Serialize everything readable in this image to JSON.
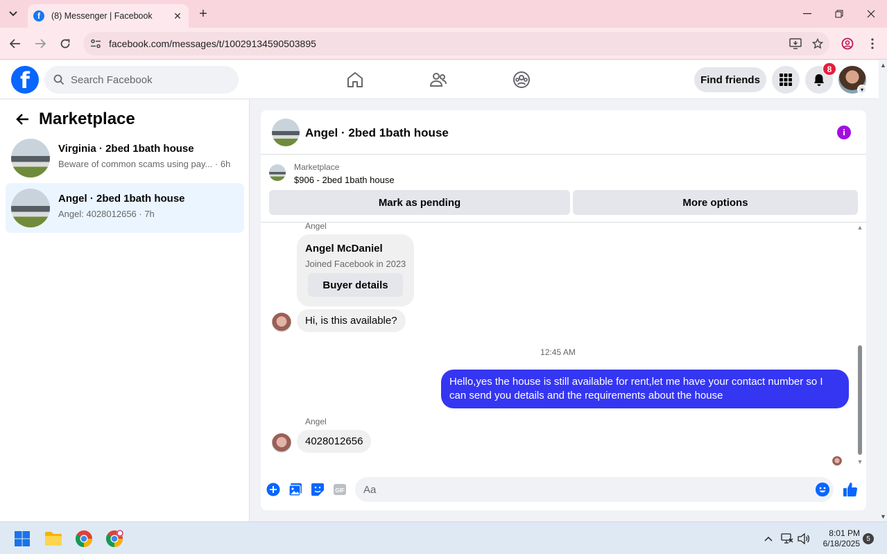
{
  "browser": {
    "tab_title": "(8) Messenger | Facebook",
    "tab_favicon": "f",
    "url": "facebook.com/messages/t/10029134590503895",
    "new_tab_label": "+"
  },
  "fb_header": {
    "search_placeholder": "Search Facebook",
    "find_friends_label": "Find friends",
    "notification_count": "8",
    "logo_letter": "f",
    "brand_color": "#0866ff",
    "badge_color": "#e41e3f"
  },
  "left_panel": {
    "title": "Marketplace",
    "conversations": [
      {
        "name": "Virginia · 2bed 1bath house",
        "preview": "Beware of common scams using pay...",
        "time": "· 6h",
        "active": false
      },
      {
        "name": "Angel · 2bed 1bath house",
        "preview": "Angel: 4028012656 · 7h",
        "time": "",
        "active": true
      }
    ]
  },
  "chat": {
    "title": "Angel · 2bed 1bath house",
    "listing_category": "Marketplace",
    "listing_price_title": "$906 - 2bed 1bath house",
    "mark_pending_label": "Mark as pending",
    "more_options_label": "More options",
    "buyer_sender_label": "Angel",
    "buyer_name": "Angel McDaniel",
    "buyer_joined": "Joined Facebook in 2023",
    "buyer_details_label": "Buyer details",
    "msg_in_1": "Hi, is this available?",
    "timestamp": "12:45 AM",
    "msg_out_1": "Hello,yes the house is still available for rent,let me have your contact number   so I can send you details and the requirements about the house",
    "sender_label_2": "Angel",
    "msg_in_2": "4028012656",
    "composer_placeholder": "Aa",
    "outgoing_bubble_color": "#3536f2",
    "info_icon_color": "#a20ee0"
  },
  "taskbar": {
    "time": "8:01 PM",
    "date": "6/18/2025",
    "notification_count": "5"
  }
}
